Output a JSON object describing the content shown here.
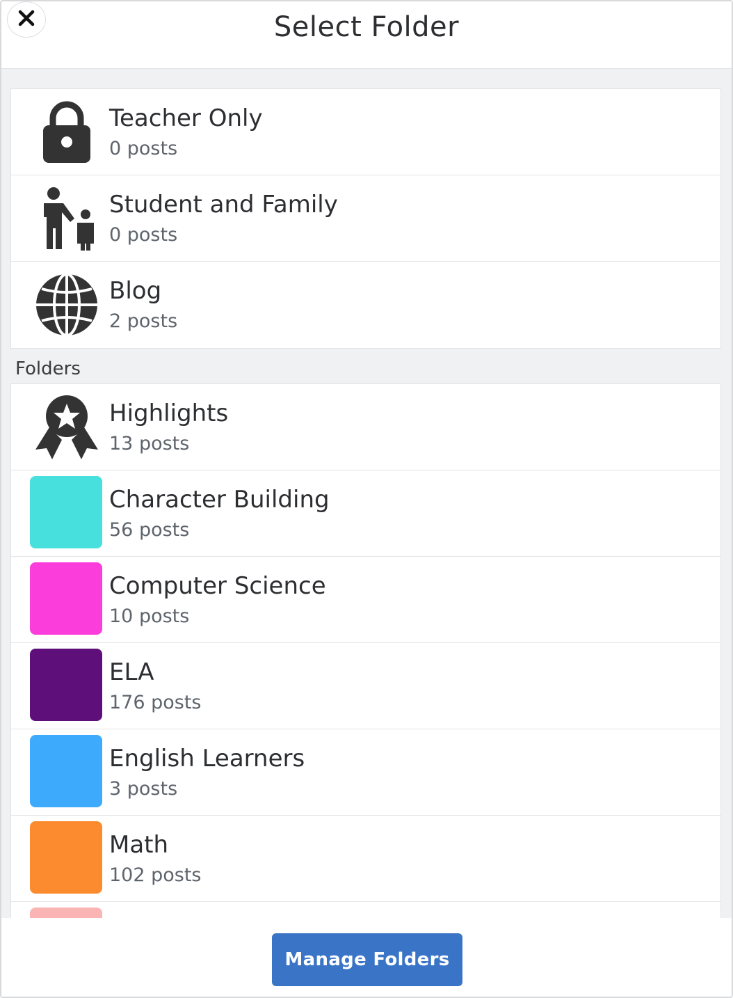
{
  "header": {
    "title": "Select Folder",
    "close_icon": "close-icon"
  },
  "fixed_items": [
    {
      "name": "Teacher Only",
      "count": "0 posts",
      "icon": "lock-icon"
    },
    {
      "name": "Student and Family",
      "count": "0 posts",
      "icon": "parent-child-icon"
    },
    {
      "name": "Blog",
      "count": "2 posts",
      "icon": "globe-icon"
    }
  ],
  "folders_label": "Folders",
  "folders": [
    {
      "name": "Highlights",
      "count": "13 posts",
      "icon": "award-ribbon-icon"
    },
    {
      "name": "Character Building",
      "count": "56 posts",
      "color": "#48e0dc"
    },
    {
      "name": "Computer Science",
      "count": "10 posts",
      "color": "#fb3ddc"
    },
    {
      "name": "ELA",
      "count": "176 posts",
      "color": "#5e0f7a"
    },
    {
      "name": "English Learners",
      "count": "3 posts",
      "color": "#3eaafb"
    },
    {
      "name": "Math",
      "count": "102 posts",
      "color": "#fb8b2e"
    },
    {
      "name": "",
      "count": "",
      "color": "#fbb4b4"
    }
  ],
  "footer": {
    "manage_label": "Manage Folders"
  }
}
